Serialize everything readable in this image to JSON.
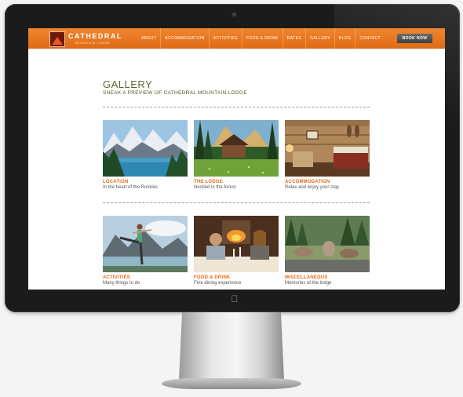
{
  "site": {
    "logo_text": "CATHEDRAL",
    "logo_sub": "MOUNTAIN LODGE"
  },
  "nav": {
    "items": [
      "ABOUT",
      "ACCOMMODATION",
      "ACTIVITIES",
      "FOOD & DRINK",
      "RATES",
      "GALLERY",
      "BLOG",
      "CONTACT"
    ],
    "book_label": "BOOK NOW"
  },
  "page": {
    "title": "GALLERY",
    "subtitle": "SNEAK A PREVIEW OF CATHEDRAL MOUNTAIN LODGE"
  },
  "gallery": [
    {
      "caption": "LOCATION",
      "desc": "In the heart of the Rockies"
    },
    {
      "caption": "THE LODGE",
      "desc": "Nestled in the forest"
    },
    {
      "caption": "ACCOMMODATION",
      "desc": "Relax and enjoy your stay"
    },
    {
      "caption": "ACTIVITIES",
      "desc": "Many things to do"
    },
    {
      "caption": "FOOD & DRINK",
      "desc": "Fine dining experience"
    },
    {
      "caption": "MISCELLANEOUS",
      "desc": "Memories at the lodge"
    }
  ],
  "colors": {
    "nav_orange": "#e8741f",
    "caption_orange": "#e46a17",
    "title_green": "#58682e"
  },
  "icons": {
    "apple": "apple-logo-icon"
  }
}
